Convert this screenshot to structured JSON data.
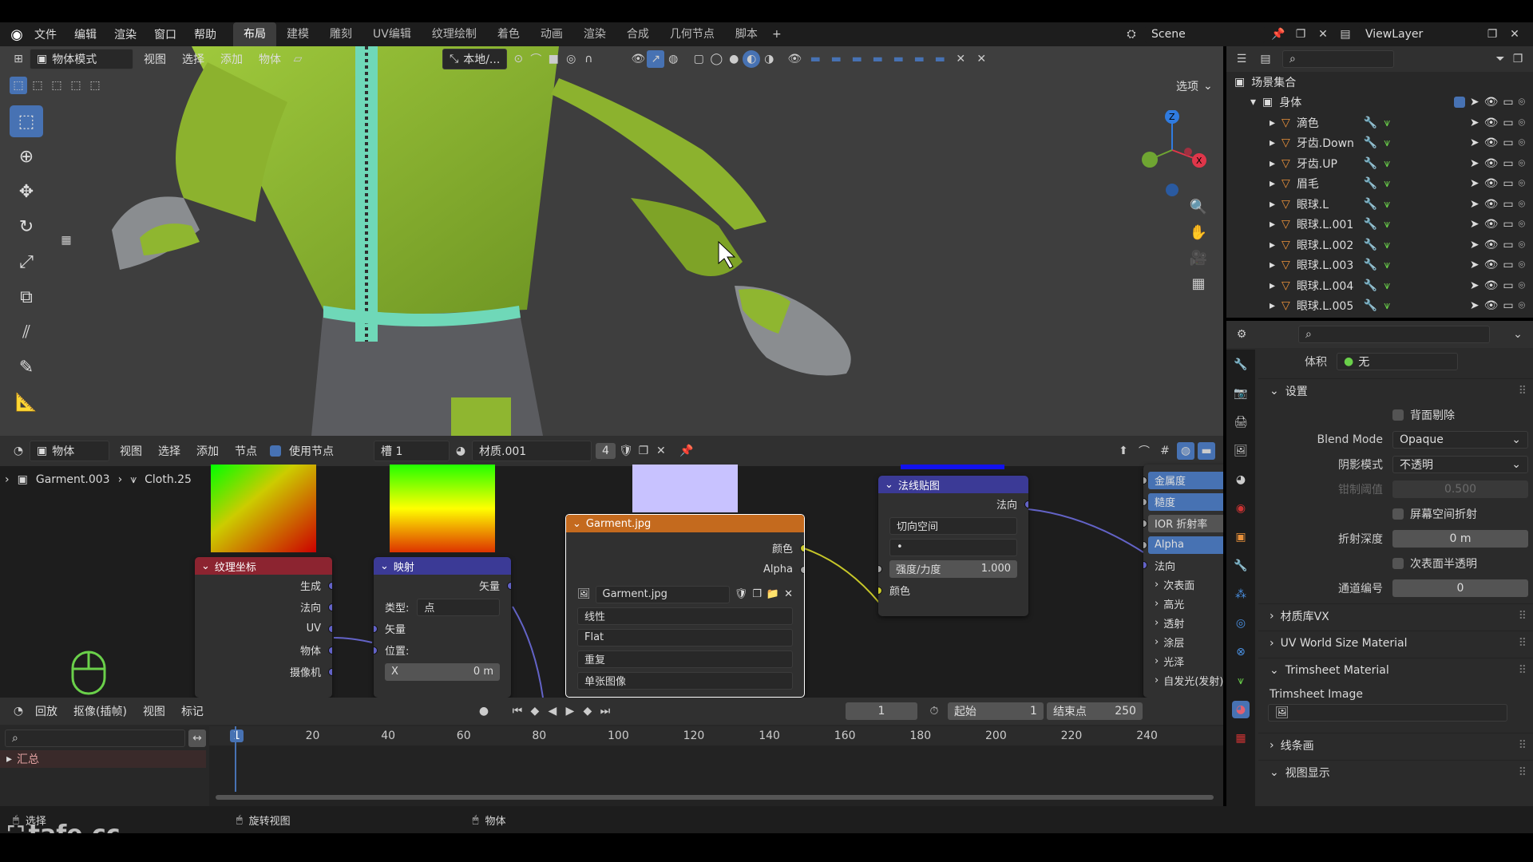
{
  "topbar": {
    "menus": [
      "文件",
      "编辑",
      "渲染",
      "窗口",
      "帮助"
    ],
    "workspaces": [
      "布局",
      "建模",
      "雕刻",
      "UV编辑",
      "纹理绘制",
      "着色",
      "动画",
      "渲染",
      "合成",
      "几何节点",
      "脚本"
    ],
    "active_workspace": "布局",
    "scene": "Scene",
    "view_layer": "ViewLayer"
  },
  "viewport": {
    "mode": "物体模式",
    "menus": [
      "视图",
      "选择",
      "添加",
      "物体"
    ],
    "transform_orientation": "本地/...",
    "options_label": "选项",
    "gizmo_axes": {
      "z": "Z",
      "x": "X"
    }
  },
  "node_editor": {
    "editor_type": "物体",
    "menus": [
      "视图",
      "选择",
      "添加",
      "节点"
    ],
    "use_nodes_label": "使用节点",
    "slot": "槽 1",
    "material": "材质.001",
    "user_count": "4",
    "breadcrumb": [
      "Garment.003",
      "Cloth.25"
    ],
    "nodes": {
      "texcoord": {
        "title": "纹理坐标",
        "outputs": [
          "生成",
          "法向",
          "UV",
          "物体",
          "摄像机"
        ]
      },
      "mapping": {
        "title": "映射",
        "output": "矢量",
        "type_label": "类型:",
        "type_value": "点",
        "vector": "矢量",
        "position": "位置:",
        "x_label": "X",
        "x_value": "0 m"
      },
      "image": {
        "title": "Garment.jpg",
        "outputs": [
          "颜色",
          "Alpha"
        ],
        "image_name": "Garment.jpg",
        "interpolation": "线性",
        "projection": "Flat",
        "extension": "重复",
        "source": "单张图像"
      },
      "normal_map": {
        "title": "法线贴图",
        "output": "法向",
        "space": "切向空间",
        "uv_map": "•",
        "strength_label": "强度/力度",
        "strength_value": "1.000",
        "color_input": "颜色"
      },
      "bsdf": {
        "inputs": [
          "金属度",
          "糙度",
          "IOR 折射率",
          "Alpha"
        ],
        "normal": "法向",
        "sections": [
          "次表面",
          "高光",
          "透射",
          "涂层",
          "光泽",
          "自发光(发射)"
        ]
      }
    }
  },
  "timeline": {
    "menus": [
      "回放",
      "抠像(插帧)",
      "视图",
      "标记"
    ],
    "current_frame": "1",
    "start_label": "起始",
    "start_value": "1",
    "end_label": "结束点",
    "end_value": "250",
    "ticks": [
      "1",
      "20",
      "40",
      "60",
      "80",
      "100",
      "120",
      "140",
      "160",
      "180",
      "200",
      "220",
      "240"
    ],
    "summary_label": "汇总"
  },
  "statusbar": {
    "select": "选择",
    "rotate": "旋转视图",
    "object": "物体",
    "watermark": "tafe.cc"
  },
  "outliner": {
    "scene_collection": "场景集合",
    "collection": "身体",
    "items": [
      "滴色",
      "牙齿.Down",
      "牙齿.UP",
      "眉毛",
      "眼球.L",
      "眼球.L.001",
      "眼球.L.002",
      "眼球.L.003",
      "眼球.L.004",
      "眼球.L.005"
    ]
  },
  "properties": {
    "volume_label": "体积",
    "volume_value": "无",
    "settings_title": "设置",
    "backface": "背面剔除",
    "blend_mode_label": "Blend Mode",
    "blend_mode_value": "Opaque",
    "shadow_mode_label": "阴影模式",
    "shadow_mode_value": "不透明",
    "clip_label": "钳制阈值",
    "clip_value": "0.500",
    "ssr_label": "屏幕空间折射",
    "refraction_depth_label": "折射深度",
    "refraction_depth_value": "0 m",
    "subsurface_label": "次表面半透明",
    "pass_index_label": "通道编号",
    "pass_index_value": "0",
    "panels": [
      "材质库VX",
      "UV World Size Material",
      "Trimsheet Material"
    ],
    "trimsheet_image_label": "Trimsheet Image",
    "panels_after": [
      "线条画",
      "视图显示"
    ]
  },
  "colors": {
    "accent": "#4772b3",
    "garment": "#8fb630",
    "zipper": "#6fd8b8",
    "image_node": "#c46a1e",
    "vector_node": "#3b3a96",
    "texcoord_node": "#8c2430"
  }
}
